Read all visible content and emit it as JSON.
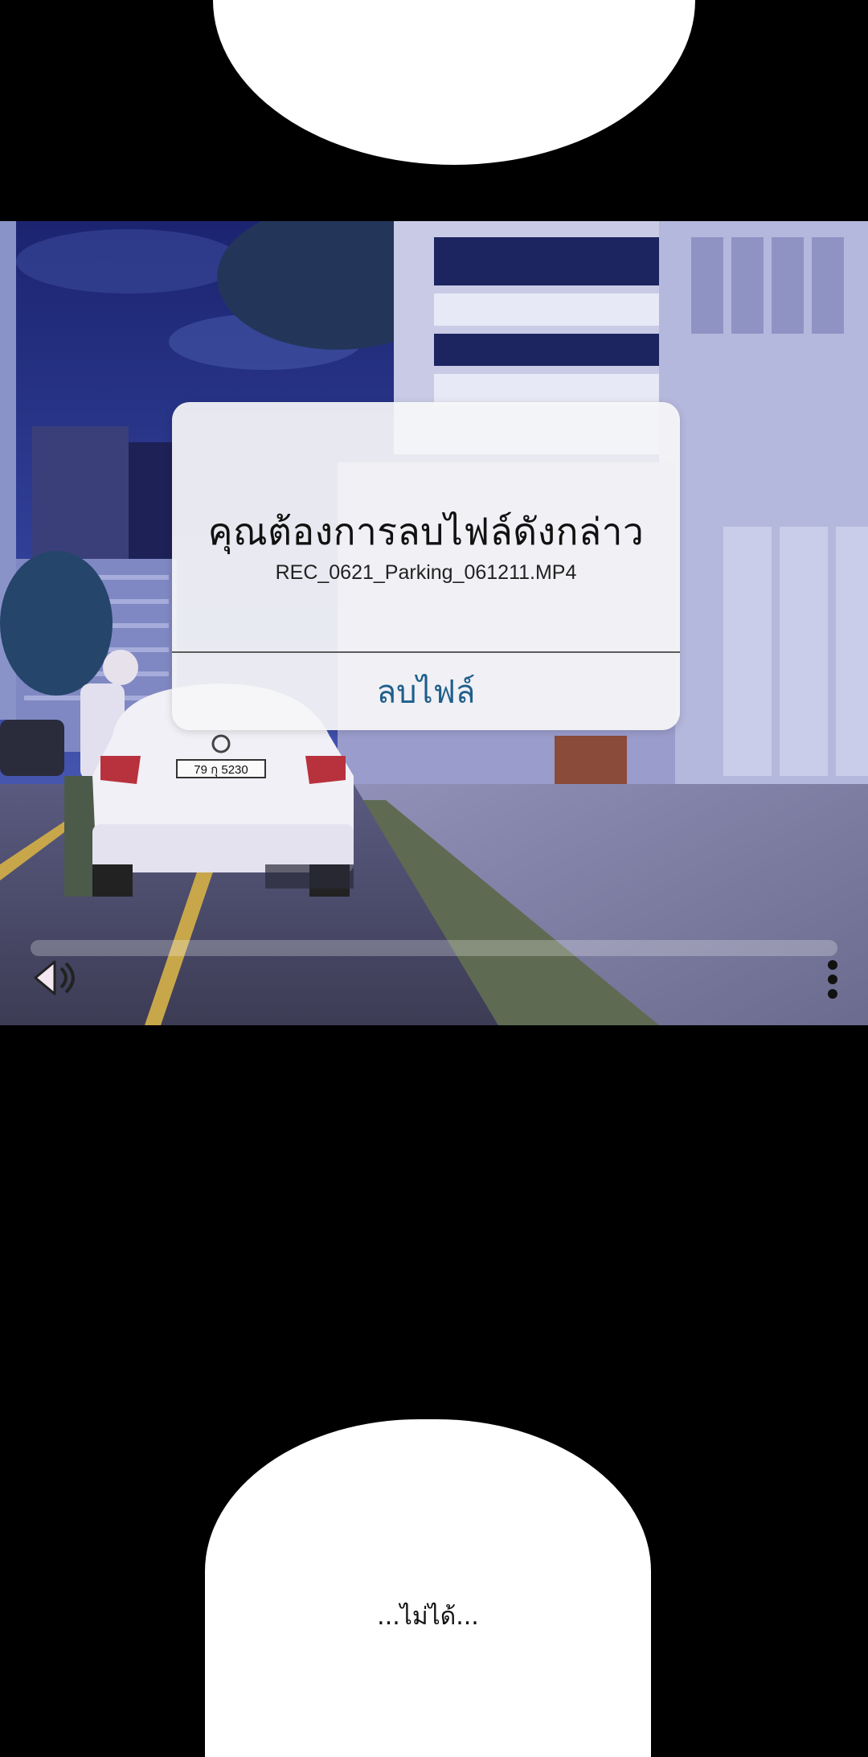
{
  "dialog": {
    "title": "คุณต้องการลบไฟล์ดังกล่าว",
    "filename": "REC_0621_Parking_061211.MP4",
    "delete_label": "ลบไฟล์"
  },
  "scene": {
    "license_plate": "79 กุ 5230"
  },
  "player": {
    "progress": 0
  },
  "bottom_bubble": {
    "text": "...ไม่ได้..."
  }
}
